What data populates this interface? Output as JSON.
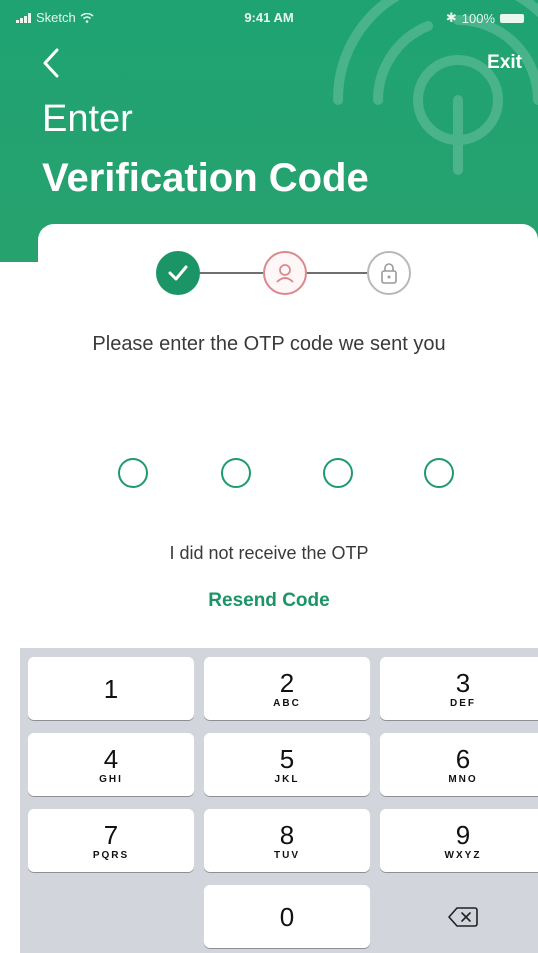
{
  "status_bar": {
    "carrier": "Sketch",
    "time": "9:41 AM",
    "battery": "100%"
  },
  "header": {
    "exit_label": "Exit",
    "title_line1": "Enter",
    "title_line2": "Verification Code"
  },
  "stepper": {
    "steps": [
      {
        "icon": "checkmark-icon",
        "state": "done"
      },
      {
        "icon": "person-icon",
        "state": "current"
      },
      {
        "icon": "lock-icon",
        "state": "pending"
      }
    ]
  },
  "otp": {
    "prompt": "Please enter the OTP code we sent you",
    "slots": 4
  },
  "resend": {
    "info": "I did not receive the OTP",
    "link": "Resend Code"
  },
  "keypad": {
    "keys": [
      {
        "digit": "1",
        "letters": ""
      },
      {
        "digit": "2",
        "letters": "ABC"
      },
      {
        "digit": "3",
        "letters": "DEF"
      },
      {
        "digit": "4",
        "letters": "GHI"
      },
      {
        "digit": "5",
        "letters": "JKL"
      },
      {
        "digit": "6",
        "letters": "MNO"
      },
      {
        "digit": "7",
        "letters": "PQRS"
      },
      {
        "digit": "8",
        "letters": "TUV"
      },
      {
        "digit": "9",
        "letters": "WXYZ"
      },
      {
        "digit": "0",
        "letters": ""
      }
    ]
  },
  "colors": {
    "brand_green": "#1fa373",
    "done_step": "#1b9566",
    "current_step": "#d98a8f",
    "pending_step": "#b8b8b8"
  }
}
